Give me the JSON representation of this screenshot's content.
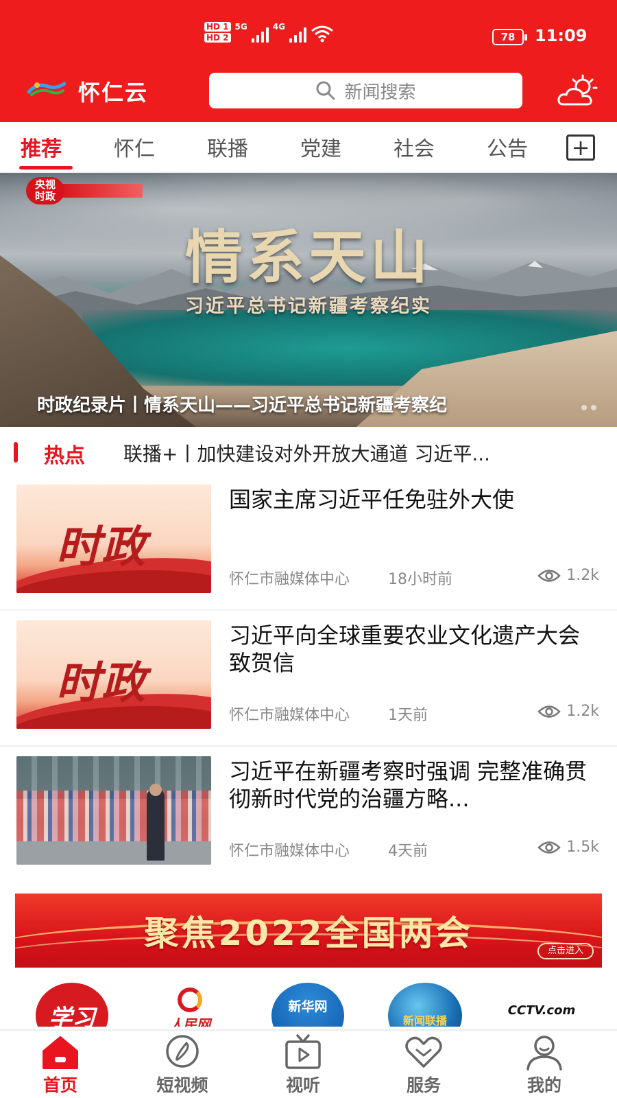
{
  "status_bar": {
    "network_1": "HD 1",
    "network_2": "HD 2",
    "net_5g": "5G",
    "net_4g": "4G",
    "battery": "78",
    "time": "11:09"
  },
  "app_bar": {
    "title": "怀仁云",
    "search_placeholder": "新闻搜索",
    "icons": {
      "logo": "app-logo",
      "weather": "weather-icon",
      "search": "search-icon"
    }
  },
  "tabs": {
    "items": [
      "推荐",
      "怀仁",
      "联播",
      "党建",
      "社会",
      "公告"
    ],
    "active": "推荐",
    "add_icon": "plus-box-icon"
  },
  "banner": {
    "badge_top": "央视",
    "badge_bottom": "时政",
    "title": "情系天山",
    "subtitle": "习近平总书记新疆考察纪实",
    "caption": "时政纪录片丨情系天山——习近平总书记新疆考察纪"
  },
  "hot": {
    "label": "热点",
    "text": "联播+丨加快建设对外开放大通道 习近平..."
  },
  "news": [
    {
      "thumb_text": "时政",
      "title": "国家主席习近平任免驻外大使",
      "source": "怀仁市融媒体中心",
      "time": "18小时前",
      "views": "1.2k"
    },
    {
      "thumb_text": "时政",
      "title": "习近平向全球重要农业文化遗产大会致贺信",
      "source": "怀仁市融媒体中心",
      "time": "1天前",
      "views": "1.2k"
    },
    {
      "thumb_text": "",
      "title": "习近平在新疆考察时强调 完整准确贯彻新时代党的治疆方略...",
      "source": "怀仁市融媒体中心",
      "time": "4天前",
      "views": "1.5k"
    }
  ],
  "promo": {
    "text": "聚焦2022全国两会",
    "button": "点击进入"
  },
  "partners": {
    "xuexi": "学习",
    "renmin": "人民网",
    "xinhua": "新华网",
    "xwlb": "新闻联播",
    "cctv": "CCTV.com"
  },
  "bottom_nav": {
    "items": [
      "首页",
      "短视频",
      "视听",
      "服务",
      "我的"
    ],
    "active": "首页"
  },
  "colors": {
    "brand_red": "#ee1c1c",
    "accent_red": "#e8141f"
  }
}
